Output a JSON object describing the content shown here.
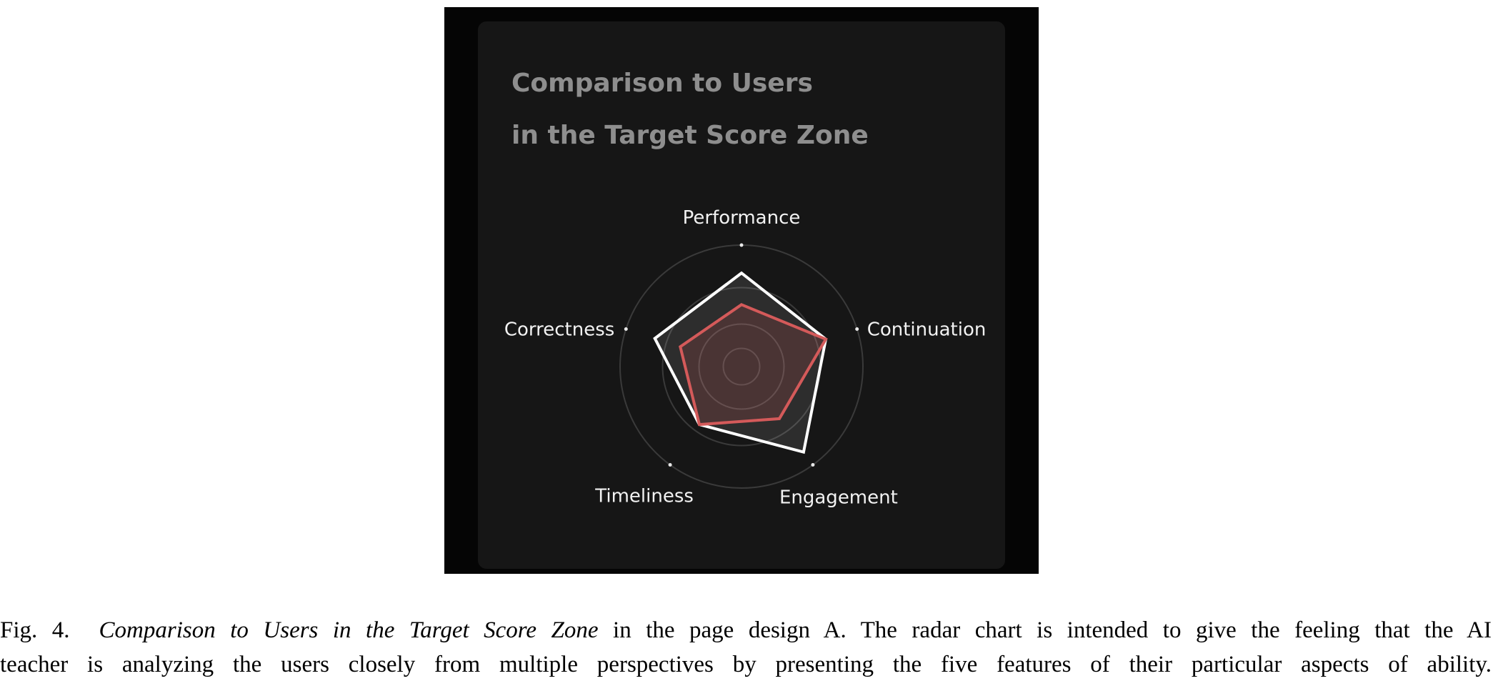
{
  "figure": {
    "card_title_line1": "Comparison to Users",
    "card_title_line2": "in the Target Score Zone",
    "colors": {
      "frame_background": "#050505",
      "card_background": "#161616",
      "title": "#8e8e8e",
      "grid_ring": "#3a3a3a",
      "series_white": "#ffffff",
      "series_red": "#d45a5a"
    }
  },
  "chart_data": {
    "type": "radar",
    "axes": [
      "Performance",
      "Continuation",
      "Engagement",
      "Timeliness",
      "Correctness"
    ],
    "range": [
      0,
      1
    ],
    "rings": [
      0.15,
      0.35,
      0.65,
      1.0
    ],
    "grid": true,
    "series": [
      {
        "values": [
          0.77,
          0.73,
          0.87,
          0.59,
          0.75
        ],
        "color": "#ffffff",
        "fill": "rgba(255,255,255,0.10)"
      },
      {
        "values": [
          0.51,
          0.73,
          0.53,
          0.59,
          0.53
        ],
        "color": "#d45a5a",
        "fill": "rgba(212,90,90,0.18)"
      }
    ]
  },
  "caption": {
    "fig_label": "Fig. 4.",
    "title_italic": "Comparison to Users in the Target Score Zone",
    "line1_rest": " in the page design A. The radar chart is intended to give the feeling that the AI",
    "line2": "teacher is analyzing the users closely from multiple perspectives by presenting the five features of their particular aspects of ability."
  }
}
